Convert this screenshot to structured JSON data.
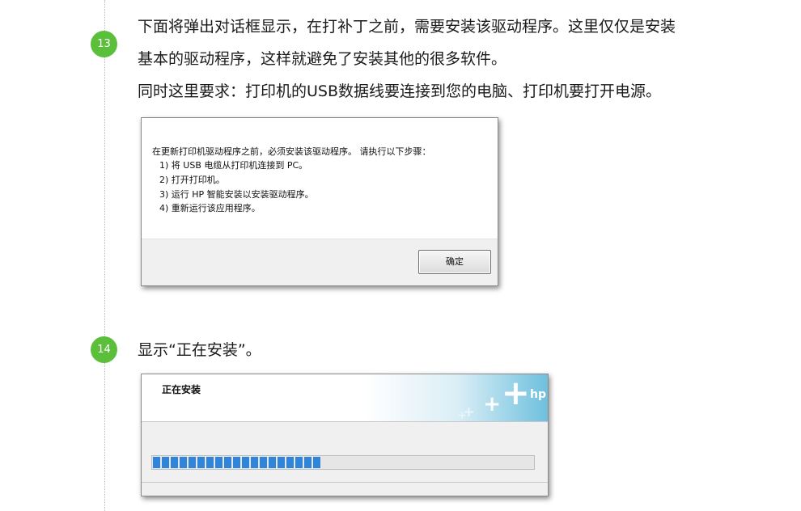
{
  "steps": [
    {
      "number": "13",
      "lines": [
        "下面将弹出对话框显示，在打补丁之前，需要安装该驱动程序。这里仅仅是安装",
        "基本的驱动程序，这样就避免了安装其他的很多软件。",
        "同时这里要求：打印机的USB数据线要连接到您的电脑、打印机要打开电源。"
      ]
    },
    {
      "number": "14",
      "lines": [
        "显示“正在安装”。"
      ]
    }
  ],
  "dialog_driver": {
    "message_lines": [
      "在更新打印机驱动程序之前，必须安装该驱动程序。 请执行以下步骤：",
      "1) 将 USB 电缆从打印机连接到 PC。",
      "2) 打开打印机。",
      "3) 运行 HP 智能安装以安装驱动程序。",
      "4) 重新运行该应用程序。"
    ],
    "ok_label": "确定"
  },
  "dialog_installing": {
    "title": "正在安装",
    "logo_text": "hp",
    "progress_fraction": 0.44
  },
  "colors": {
    "badge": "#5cbf3c",
    "progress": "#2f86d8",
    "header_accent": "#6fc0de"
  }
}
